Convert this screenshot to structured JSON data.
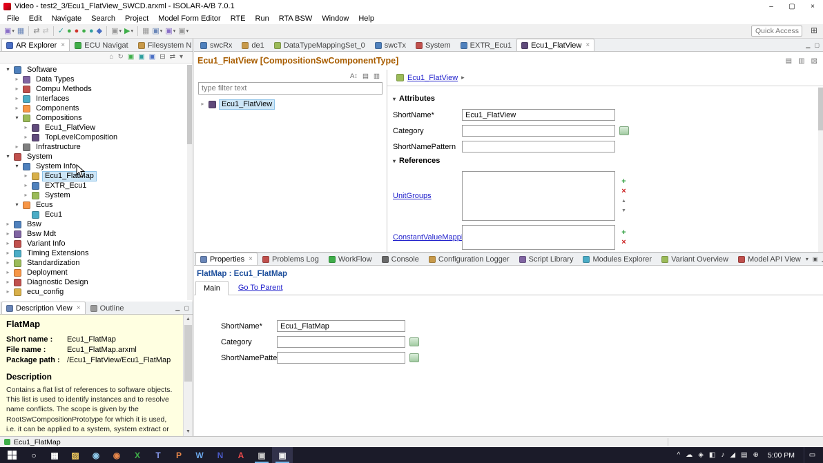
{
  "window": {
    "title": "Video - test2_3/Ecu1_FlatView_SWCD.arxml - ISOLAR-A/B 7.0.1",
    "controls": {
      "minimize": "–",
      "maximize": "▢",
      "close": "×"
    }
  },
  "menubar": [
    "File",
    "Edit",
    "Navigate",
    "Search",
    "Project",
    "Model Form Editor",
    "RTE",
    "Run",
    "RTA BSW",
    "Window",
    "Help"
  ],
  "toolbar": {
    "quick_access": "Quick Access",
    "perspective_icon": "⊞",
    "icons": [
      {
        "name": "new-wizard-icon",
        "glyph": "▣",
        "color": "#8a6fc8",
        "caret": true
      },
      {
        "name": "save-icon",
        "glyph": "▦",
        "color": "#6a86b8"
      },
      {
        "name": "separator"
      },
      {
        "name": "link-with-editor-icon",
        "glyph": "⇄",
        "color": "#8a8a8a"
      },
      {
        "name": "unlink-icon",
        "glyph": "⇄",
        "color": "#c0c0c0"
      },
      {
        "name": "separator"
      },
      {
        "name": "validate-icon",
        "glyph": "✓",
        "color": "#2e9e9e"
      },
      {
        "name": "run-model-check-icon",
        "glyph": "●",
        "color": "#3fae49"
      },
      {
        "name": "stop-icon",
        "glyph": "●",
        "color": "#d0342c"
      },
      {
        "name": "resume-icon",
        "glyph": "●",
        "color": "#3fae49"
      },
      {
        "name": "pause-icon",
        "glyph": "●",
        "color": "#2e9e9e"
      },
      {
        "name": "gem-icon",
        "glyph": "◆",
        "color": "#4a6fc4"
      },
      {
        "name": "separator"
      },
      {
        "name": "marker-icon",
        "glyph": "▣",
        "color": "#9a9a9a",
        "caret": true
      },
      {
        "name": "run-icon",
        "glyph": "▶",
        "color": "#3fae49",
        "caret": true
      },
      {
        "name": "separator"
      },
      {
        "name": "grid-view-icon",
        "glyph": "▦",
        "color": "#9a9a9a"
      },
      {
        "name": "run-config-icon",
        "glyph": "▣",
        "color": "#6a86b8",
        "caret": true
      },
      {
        "name": "debug-config-icon",
        "glyph": "▣",
        "color": "#8a6fc8",
        "caret": true
      },
      {
        "name": "profile-config-icon",
        "glyph": "▣",
        "color": "#9a9a9a",
        "caret": true
      }
    ]
  },
  "explorer": {
    "tabs": [
      {
        "label": "AR Explorer",
        "active": true,
        "icon_color": "#4a6fc4"
      },
      {
        "label": "ECU Navigat",
        "active": false,
        "icon_color": "#3fae49"
      },
      {
        "label": "Filesystem N",
        "active": false,
        "icon_color": "#c89a4a"
      }
    ],
    "corner_icons": [
      {
        "name": "minimize-view-icon",
        "glyph": "▁"
      },
      {
        "name": "maximize-view-icon",
        "glyph": "▢"
      }
    ],
    "toolbar_icons": [
      {
        "name": "home-icon",
        "glyph": "⌂",
        "color": "#8a8a8a"
      },
      {
        "name": "refresh-icon",
        "glyph": "↻",
        "color": "#8a8a8a"
      },
      {
        "name": "new-element-icon",
        "glyph": "▣",
        "color": "#3fae49"
      },
      {
        "name": "import-icon",
        "glyph": "▣",
        "color": "#2e9e9e"
      },
      {
        "name": "export-icon",
        "glyph": "▣",
        "color": "#4a6fc4"
      },
      {
        "name": "collapse-all-icon",
        "glyph": "⊟",
        "color": "#6a6a6a"
      },
      {
        "name": "link-editor-icon",
        "glyph": "⇄",
        "color": "#6a6a6a"
      },
      {
        "name": "view-menu-icon",
        "glyph": "▾",
        "color": "#6a6a6a"
      }
    ],
    "tree": [
      {
        "label": "Software",
        "level": 0,
        "arrow": "expanded",
        "icon": "software-icon",
        "color": "#4f81bd"
      },
      {
        "label": "Data Types",
        "level": 1,
        "arrow": "collapsed",
        "icon": "data-types-icon",
        "color": "#8064a2"
      },
      {
        "label": "Compu Methods",
        "level": 1,
        "arrow": "collapsed",
        "icon": "compu-methods-icon",
        "color": "#c0504d"
      },
      {
        "label": "Interfaces",
        "level": 1,
        "arrow": "collapsed",
        "icon": "interfaces-icon",
        "color": "#4bacc6"
      },
      {
        "label": "Components",
        "level": 1,
        "arrow": "collapsed",
        "icon": "components-icon",
        "color": "#f79646"
      },
      {
        "label": "Compositions",
        "level": 1,
        "arrow": "expanded",
        "icon": "compositions-icon",
        "color": "#9bbb59"
      },
      {
        "label": "Ecu1_FlatView",
        "level": 2,
        "arrow": "collapsed",
        "icon": "composition-icon",
        "color": "#604a7b"
      },
      {
        "label": "TopLevelComposition",
        "level": 2,
        "arrow": "collapsed",
        "icon": "composition-icon",
        "color": "#604a7b"
      },
      {
        "label": "Infrastructure",
        "level": 1,
        "arrow": "collapsed",
        "icon": "infrastructure-icon",
        "color": "#7f7f7f"
      },
      {
        "label": "System",
        "level": 0,
        "arrow": "expanded",
        "icon": "system-icon",
        "color": "#c0504d"
      },
      {
        "label": "System Info",
        "level": 1,
        "arrow": "expanded",
        "icon": "system-info-icon",
        "color": "#4f81bd"
      },
      {
        "label": "Ecu1_FlatMap",
        "level": 2,
        "arrow": "collapsed",
        "icon": "flatmap-icon",
        "color": "#d8b04a",
        "selected": true
      },
      {
        "label": "EXTR_Ecu1",
        "level": 2,
        "arrow": "collapsed",
        "icon": "extract-icon",
        "color": "#4f81bd"
      },
      {
        "label": "System",
        "level": 2,
        "arrow": "collapsed",
        "icon": "system-item-icon",
        "color": "#9bbb59"
      },
      {
        "label": "Ecus",
        "level": 1,
        "arrow": "expanded",
        "icon": "ecus-icon",
        "color": "#f79646"
      },
      {
        "label": "Ecu1",
        "level": 2,
        "arrow": "none",
        "icon": "ecu-icon",
        "color": "#4bacc6"
      },
      {
        "label": "Bsw",
        "level": 0,
        "arrow": "collapsed",
        "icon": "bsw-icon",
        "color": "#4f81bd"
      },
      {
        "label": "Bsw Mdt",
        "level": 0,
        "arrow": "collapsed",
        "icon": "bsw-mdt-icon",
        "color": "#8064a2"
      },
      {
        "label": "Variant Info",
        "level": 0,
        "arrow": "collapsed",
        "icon": "variant-info-icon",
        "color": "#c0504d"
      },
      {
        "label": "Timing Extensions",
        "level": 0,
        "arrow": "collapsed",
        "icon": "timing-extensions-icon",
        "color": "#4bacc6"
      },
      {
        "label": "Standardization",
        "level": 0,
        "arrow": "collapsed",
        "icon": "standardization-icon",
        "color": "#9bbb59"
      },
      {
        "label": "Deployment",
        "level": 0,
        "arrow": "collapsed",
        "icon": "deployment-icon",
        "color": "#f79646"
      },
      {
        "label": "Diagnostic Design",
        "level": 0,
        "arrow": "collapsed",
        "icon": "diagnostic-design-icon",
        "color": "#c0504d"
      },
      {
        "label": "ecu_config",
        "level": 0,
        "arrow": "collapsed",
        "icon": "ecu-config-icon",
        "color": "#d8b04a"
      }
    ]
  },
  "description_view": {
    "tabs": [
      {
        "label": "Description View",
        "active": true,
        "icon_color": "#6a86b8"
      },
      {
        "label": "Outline",
        "active": false,
        "icon_color": "#9a9a9a"
      }
    ],
    "corner_icons": [
      {
        "name": "minimize-view-icon",
        "glyph": "▁"
      },
      {
        "name": "maximize-view-icon",
        "glyph": "▢"
      }
    ],
    "title": "FlatMap",
    "rows": [
      {
        "label": "Short name :",
        "value": "Ecu1_FlatMap"
      },
      {
        "label": "File name :",
        "value": "Ecu1_FlatMap.arxml"
      },
      {
        "label": "Package path :",
        "value": "/Ecu1_FlatView/Ecu1_FlatMap"
      }
    ],
    "section_title": "Description",
    "body": "Contains a flat list of references to software objects. This list is used to identify instances and to resolve name conflicts. The scope is given by the RootSwCompositionPrototype for which it is used, i.e. it can be applied to a system, system extract or ECU-extract. An"
  },
  "editor": {
    "tabs": [
      {
        "label": "swcRx",
        "icon_color": "#4f81bd"
      },
      {
        "label": "de1",
        "icon_color": "#c89a4a"
      },
      {
        "label": "DataTypeMappingSet_0",
        "icon_color": "#9bbb59"
      },
      {
        "label": "swcTx",
        "icon_color": "#4f81bd"
      },
      {
        "label": "System",
        "icon_color": "#c0504d"
      },
      {
        "label": "EXTR_Ecu1",
        "icon_color": "#4f81bd"
      },
      {
        "label": "Ecu1_FlatView",
        "icon_color": "#604a7b",
        "active": true
      }
    ],
    "tabbar_corner_icons": [
      {
        "name": "minimize-editor-icon",
        "glyph": "▁"
      },
      {
        "name": "maximize-editor-icon",
        "glyph": "▢"
      }
    ],
    "heading": "Ecu1_FlatView [CompositionSwComponentType]",
    "heading_icons": [
      {
        "name": "toggle-form-icon",
        "glyph": "▤"
      },
      {
        "name": "toggle-source-icon",
        "glyph": "▥"
      },
      {
        "name": "editor-menu-icon",
        "glyph": "▧"
      }
    ],
    "left_header_icons": [
      {
        "name": "sort-alphabetical-icon",
        "glyph": "A↕"
      },
      {
        "name": "expand-all-icon",
        "glyph": "▤"
      },
      {
        "name": "collapse-all-icon",
        "glyph": "▥"
      }
    ],
    "filter_placeholder": "type filter text",
    "tree_node": "Ecu1_FlatView",
    "breadcrumb": "Ecu1_FlatView",
    "attributes_section": "Attributes",
    "references_section": "References",
    "shortname_label": "ShortName*",
    "shortname_value": "Ecu1_FlatView",
    "category_label": "Category",
    "category_value": "",
    "pattern_label": "ShortNamePattern",
    "pattern_value": "",
    "unitgroups_label": "UnitGroups",
    "constmapping_label": "ConstantValueMappi"
  },
  "properties": {
    "tabs": [
      {
        "label": "Properties",
        "active": true,
        "icon_color": "#6a86b8"
      },
      {
        "label": "Problems Log",
        "icon_color": "#c0504d"
      },
      {
        "label": "WorkFlow",
        "icon_color": "#3fae49"
      },
      {
        "label": "Console",
        "icon_color": "#6a6a6a"
      },
      {
        "label": "Configuration Logger",
        "icon_color": "#c89a4a"
      },
      {
        "label": "Script Library",
        "icon_color": "#8064a2"
      },
      {
        "label": "Modules Explorer",
        "icon_color": "#4bacc6"
      },
      {
        "label": "Variant Overview",
        "icon_color": "#9bbb59"
      },
      {
        "label": "Model API View",
        "icon_color": "#c0504d"
      }
    ],
    "corner_icons": [
      {
        "name": "view-menu-icon",
        "glyph": "▾"
      },
      {
        "name": "restore-view-icon",
        "glyph": "▣"
      },
      {
        "name": "minimize-view-icon",
        "glyph": "▁"
      },
      {
        "name": "maximize-view-icon",
        "glyph": "▢"
      }
    ],
    "title": "FlatMap : Ecu1_FlatMap",
    "main_tab": "Main",
    "go_to_parent": "Go To Parent",
    "shortname_label": "ShortName*",
    "shortname_value": "Ecu1_FlatMap",
    "category_label": "Category",
    "category_value": "",
    "pattern_label": "ShortNamePattern",
    "pattern_value": ""
  },
  "statusbar": {
    "text": "Ecu1_FlatMap"
  },
  "taskbar": {
    "time": "5:00 PM",
    "notification_icon": "▭",
    "apps": [
      {
        "name": "start-button",
        "type": "start"
      },
      {
        "name": "search-icon",
        "glyph": "○",
        "color": "#ffffff"
      },
      {
        "name": "task-view-icon",
        "glyph": "▦",
        "color": "#ffffff"
      },
      {
        "name": "file-explorer-icon",
        "glyph": "▨",
        "color": "#f7d060"
      },
      {
        "name": "browser-icon",
        "glyph": "◉",
        "color": "#8ec7e8"
      },
      {
        "name": "firefox-icon",
        "glyph": "◉",
        "color": "#e8874a"
      },
      {
        "name": "excel-icon",
        "glyph": "X",
        "color": "#3fae49"
      },
      {
        "name": "teams-icon",
        "glyph": "T",
        "color": "#8a9cf0"
      },
      {
        "name": "powerpoint-icon",
        "glyph": "P",
        "color": "#e8874a"
      },
      {
        "name": "word-icon",
        "glyph": "W",
        "color": "#6aa5e8"
      },
      {
        "name": "notes-icon",
        "glyph": "N",
        "color": "#4a5ac8"
      },
      {
        "name": "acrobat-icon",
        "glyph": "A",
        "color": "#e84a4a"
      },
      {
        "name": "tool-running-icon",
        "glyph": "▣",
        "color": "#c8c8c8",
        "running": true
      },
      {
        "name": "isolar-taskbar-icon",
        "glyph": "▣",
        "color": "#f0f0f0",
        "active": true,
        "running": true
      }
    ],
    "tray": [
      {
        "name": "hidden-icons-chevron",
        "glyph": "^"
      },
      {
        "name": "tray-cloud-icon",
        "glyph": "☁"
      },
      {
        "name": "tray-shield-icon",
        "glyph": "◈"
      },
      {
        "name": "tray-display-icon",
        "glyph": "◧"
      },
      {
        "name": "tray-sound-icon",
        "glyph": "♪"
      },
      {
        "name": "tray-network-icon",
        "glyph": "◢"
      },
      {
        "name": "tray-keyboard-icon",
        "glyph": "▤"
      },
      {
        "name": "tray-power-icon",
        "glyph": "⊕"
      }
    ]
  }
}
